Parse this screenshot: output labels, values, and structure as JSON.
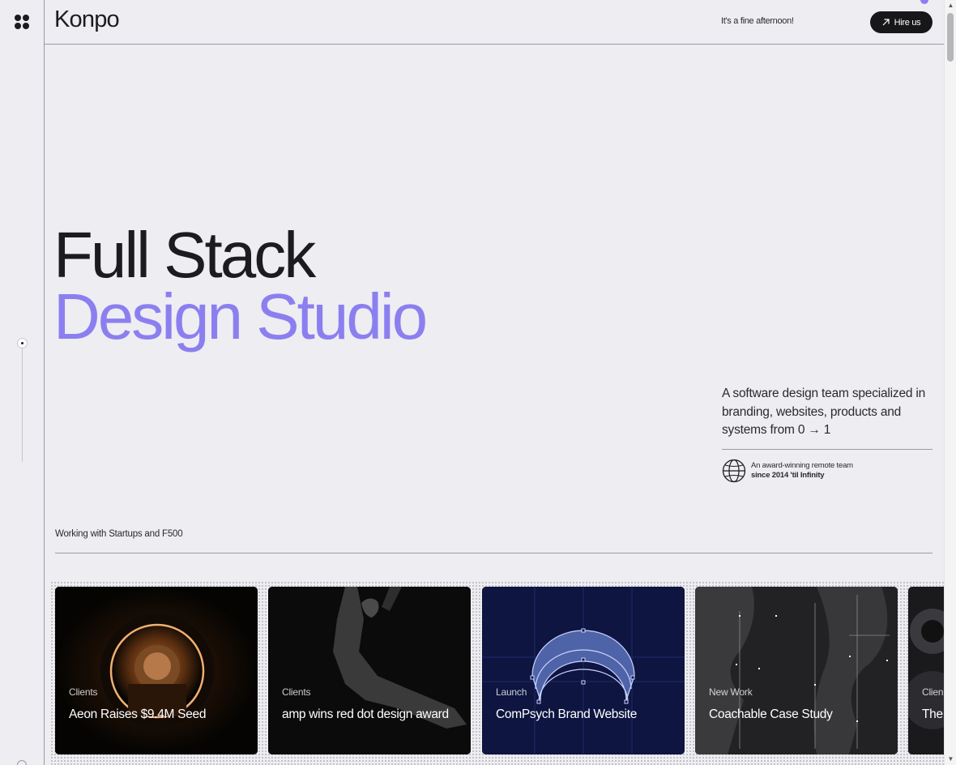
{
  "header": {
    "logo": "Konpo",
    "greeting": "It's a fine afternoon!",
    "hire_label": "Hire us"
  },
  "hero": {
    "line1": "Full Stack",
    "line2": "Design Studio"
  },
  "intro": {
    "text": "A software design team specialized in branding, websites, products and systems from 0 → 1",
    "award_line1": "An award-winning remote team",
    "award_line2": "since 2014 'til Infinity"
  },
  "working": "Working with Startups and F500",
  "cards": [
    {
      "tag": "Clients",
      "title": "Aeon Raises $9.4M Seed"
    },
    {
      "tag": "Clients",
      "title": "amp wins red dot design award"
    },
    {
      "tag": "Launch",
      "title": "ComPsych Brand Website"
    },
    {
      "tag": "New Work",
      "title": "Coachable Case Study"
    },
    {
      "tag": "Clien",
      "title": "The Has"
    }
  ],
  "colors": {
    "background": "#eeedf2",
    "accent": "#8b7ff0",
    "dark": "#17171a"
  },
  "icons": {
    "menu": "four-dots-icon",
    "hire": "arrow-up-right-icon",
    "award": "globe-icon"
  }
}
